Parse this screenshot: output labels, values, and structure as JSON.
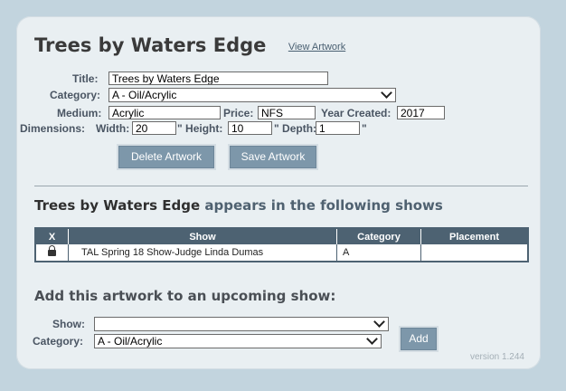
{
  "artwork": {
    "title": "Trees by Waters Edge",
    "view_link": "View Artwork"
  },
  "form": {
    "title_label": "Title:",
    "title_value": "Trees by Waters Edge",
    "category_label": "Category:",
    "category_value": "A - Oil/Acrylic",
    "medium_label": "Medium:",
    "medium_value": "Acrylic",
    "price_label": "Price:",
    "price_value": "NFS",
    "year_label": "Year Created:",
    "year_value": "2017",
    "dimensions_label": "Dimensions:",
    "width_label": "Width:",
    "width_value": "20",
    "height_label": "\" Height:",
    "height_value": "10",
    "depth_label": "\" Depth:",
    "depth_value": "1",
    "depth_suffix": "\""
  },
  "buttons": {
    "delete": "Delete Artwork",
    "save": "Save Artwork",
    "add": "Add"
  },
  "shows": {
    "heading_name": "Trees by Waters Edge",
    "heading_rest": " appears in the following shows",
    "columns": [
      "X",
      "Show",
      "Category",
      "Placement"
    ],
    "rows": [
      {
        "show": "TAL Spring 18 Show-Judge Linda Dumas",
        "category": "A",
        "placement": ""
      }
    ]
  },
  "add_section": {
    "heading": "Add this artwork to an upcoming show:",
    "show_label": "Show:",
    "show_value": "",
    "category_label": "Category:",
    "category_value": "A - Oil/Acrylic"
  },
  "version": "version 1.244"
}
